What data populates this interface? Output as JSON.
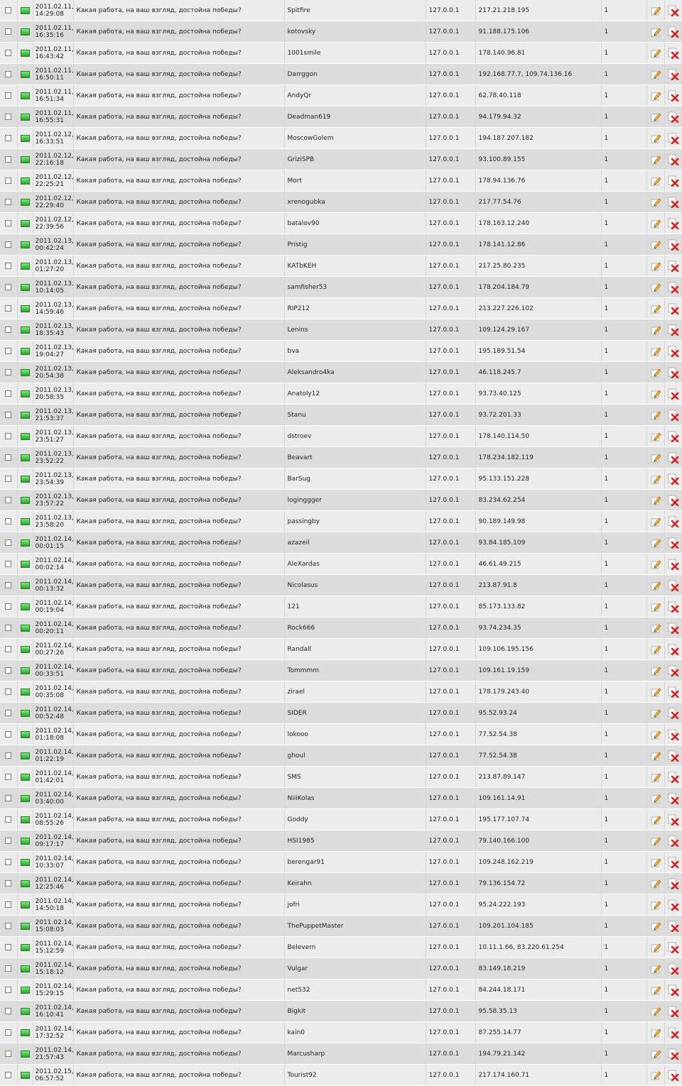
{
  "question": "Какая работа, на ваш взгляд, достойна победы?",
  "local_ip": "127.0.0.1",
  "colors": {
    "status_green": "#22a822",
    "delete_red": "#d42020",
    "edit_orange": "#e09020"
  },
  "icons": {
    "status": "status-flag-icon",
    "edit": "edit-pencil-icon",
    "delete": "delete-x-icon"
  },
  "rows": [
    {
      "date": "2011.02.11,",
      "time": "14:29:08",
      "user": "Spitfire",
      "ip": "217.21.218.195",
      "count": "1"
    },
    {
      "date": "2011.02.11,",
      "time": "16:35:16",
      "user": "kotovsky",
      "ip": "91.188.175.106",
      "count": "1"
    },
    {
      "date": "2011.02.11,",
      "time": "16:43:42",
      "user": "1001smile",
      "ip": "178.140.96.81",
      "count": "1"
    },
    {
      "date": "2011.02.11,",
      "time": "16:50:11",
      "user": "Darrggon",
      "ip": "192.168.77.7, 109.74.136.16",
      "count": "1"
    },
    {
      "date": "2011.02.11,",
      "time": "16:51:34",
      "user": "AndyQr",
      "ip": "62.78.40.118",
      "count": "1"
    },
    {
      "date": "2011.02.11,",
      "time": "16:55:31",
      "user": "Deadman619",
      "ip": "94.179.94.32",
      "count": "1"
    },
    {
      "date": "2011.02.12,",
      "time": "16:33:51",
      "user": "MoscowGolem",
      "ip": "194.187.207.182",
      "count": "1"
    },
    {
      "date": "2011.02.12,",
      "time": "22:16:18",
      "user": "GriziSPB",
      "ip": "93.100.89.155",
      "count": "1"
    },
    {
      "date": "2011.02.12,",
      "time": "22:25:21",
      "user": "Mort",
      "ip": "178.94.136.76",
      "count": "1"
    },
    {
      "date": "2011.02.12,",
      "time": "22:29:40",
      "user": "xrenogubka",
      "ip": "217.77.54.76",
      "count": "1"
    },
    {
      "date": "2011.02.12,",
      "time": "22:39:56",
      "user": "batalov90",
      "ip": "178.163.12.240",
      "count": "1"
    },
    {
      "date": "2011.02.13,",
      "time": "00:42:24",
      "user": "Pristig",
      "ip": "178.141.12.86",
      "count": "1"
    },
    {
      "date": "2011.02.13,",
      "time": "01:27:20",
      "user": "KATbKEH",
      "ip": "217.25.80.235",
      "count": "1"
    },
    {
      "date": "2011.02.13,",
      "time": "10:14:05",
      "user": "samfisher53",
      "ip": "178.204.184.79",
      "count": "1"
    },
    {
      "date": "2011.02.13,",
      "time": "14:59:46",
      "user": "RIP212",
      "ip": "213.227.226.102",
      "count": "1"
    },
    {
      "date": "2011.02.13,",
      "time": "18:35:43",
      "user": "Lenins",
      "ip": "109.124.29.167",
      "count": "1"
    },
    {
      "date": "2011.02.13,",
      "time": "19:04:27",
      "user": "bva",
      "ip": "195.189.51.54",
      "count": "1"
    },
    {
      "date": "2011.02.13,",
      "time": "20:54:38",
      "user": "Aleksandro4ka",
      "ip": "46.118.245.7",
      "count": "1"
    },
    {
      "date": "2011.02.13,",
      "time": "20:58:35",
      "user": "Anatoly12",
      "ip": "93.73.40.125",
      "count": "1"
    },
    {
      "date": "2011.02.13,",
      "time": "21:53:37",
      "user": "Stanu",
      "ip": "93.72.201.33",
      "count": "1"
    },
    {
      "date": "2011.02.13,",
      "time": "23:51:27",
      "user": "dstroev",
      "ip": "178.140.114.50",
      "count": "1"
    },
    {
      "date": "2011.02.13,",
      "time": "23:52:22",
      "user": "Beavart",
      "ip": "178.234.182.119",
      "count": "1"
    },
    {
      "date": "2011.02.13,",
      "time": "23:54:39",
      "user": "BarSug",
      "ip": "95.133.151.228",
      "count": "1"
    },
    {
      "date": "2011.02.13,",
      "time": "23:57:22",
      "user": "loginggger",
      "ip": "83.234.62.254",
      "count": "1"
    },
    {
      "date": "2011.02.13,",
      "time": "23:58:20",
      "user": "passingby",
      "ip": "90.189.149.98",
      "count": "1"
    },
    {
      "date": "2011.02.14,",
      "time": "00:01:15",
      "user": "azazeil",
      "ip": "93.84.185.109",
      "count": "1"
    },
    {
      "date": "2011.02.14,",
      "time": "00:02:14",
      "user": "AleXardas",
      "ip": "46.61.49.215",
      "count": "1"
    },
    {
      "date": "2011.02.14,",
      "time": "00:13:32",
      "user": "Nicolasus",
      "ip": "213.87.91.8",
      "count": "1"
    },
    {
      "date": "2011.02.14,",
      "time": "00:19:04",
      "user": "121",
      "ip": "85.173.133.82",
      "count": "1"
    },
    {
      "date": "2011.02.14,",
      "time": "00:20:11",
      "user": "Rock666",
      "ip": "93.74.234.35",
      "count": "1"
    },
    {
      "date": "2011.02.14,",
      "time": "00:27:26",
      "user": "Randall",
      "ip": "109.106.195.156",
      "count": "1"
    },
    {
      "date": "2011.02.14,",
      "time": "00:33:51",
      "user": "Tommmm",
      "ip": "109.161.19.159",
      "count": "1"
    },
    {
      "date": "2011.02.14,",
      "time": "00:35:08",
      "user": "zirael",
      "ip": "178.179.243.40",
      "count": "1"
    },
    {
      "date": "2011.02.14,",
      "time": "00:52:48",
      "user": "SIDER",
      "ip": "95.52.93.24",
      "count": "1"
    },
    {
      "date": "2011.02.14,",
      "time": "01:18:08",
      "user": "lokooo",
      "ip": "77.52.54.38",
      "count": "1"
    },
    {
      "date": "2011.02.14,",
      "time": "01:22:19",
      "user": "ghoul",
      "ip": "77.52.54.38",
      "count": "1"
    },
    {
      "date": "2011.02.14,",
      "time": "01:42:01",
      "user": "SMS",
      "ip": "213.87.89.147",
      "count": "1"
    },
    {
      "date": "2011.02.14,",
      "time": "03:40:00",
      "user": "NiiiKolas",
      "ip": "109.161.14.91",
      "count": "1"
    },
    {
      "date": "2011.02.14,",
      "time": "08:55:26",
      "user": "Goddy",
      "ip": "195.177.107.74",
      "count": "1"
    },
    {
      "date": "2011.02.14,",
      "time": "09:17:17",
      "user": "HSI1985",
      "ip": "79.140.166.100",
      "count": "1"
    },
    {
      "date": "2011.02.14,",
      "time": "10:33:07",
      "user": "berengar91",
      "ip": "109.248.162.219",
      "count": "1"
    },
    {
      "date": "2011.02.14,",
      "time": "12:25:46",
      "user": "Keirahn",
      "ip": "79.136.154.72",
      "count": "1"
    },
    {
      "date": "2011.02.14,",
      "time": "14:50:18",
      "user": "jofri",
      "ip": "95.24.222.193",
      "count": "1"
    },
    {
      "date": "2011.02.14,",
      "time": "15:08:03",
      "user": "ThePuppetMaster",
      "ip": "109.201.104.185",
      "count": "1"
    },
    {
      "date": "2011.02.14,",
      "time": "15:12:59",
      "user": "Belevern",
      "ip": "10.11.1.66, 83.220.61.254",
      "count": "1"
    },
    {
      "date": "2011.02.14,",
      "time": "15:18:12",
      "user": "Vulgar",
      "ip": "83.149.18.219",
      "count": "1"
    },
    {
      "date": "2011.02.14,",
      "time": "15:29:15",
      "user": "net532",
      "ip": "84.244.18.171",
      "count": "1"
    },
    {
      "date": "2011.02.14,",
      "time": "16:10:41",
      "user": "Bigkit",
      "ip": "95.58.35.13",
      "count": "1"
    },
    {
      "date": "2011.02.14,",
      "time": "17:32:52",
      "user": "kain0",
      "ip": "87.255.14.77",
      "count": "1"
    },
    {
      "date": "2011.02.14,",
      "time": "21:57:43",
      "user": "Marcusharp",
      "ip": "194.79.21.142",
      "count": "1"
    },
    {
      "date": "2011.02.15,",
      "time": "06:57:52",
      "user": "Tourist92",
      "ip": "217.174.160.71",
      "count": "1"
    }
  ]
}
